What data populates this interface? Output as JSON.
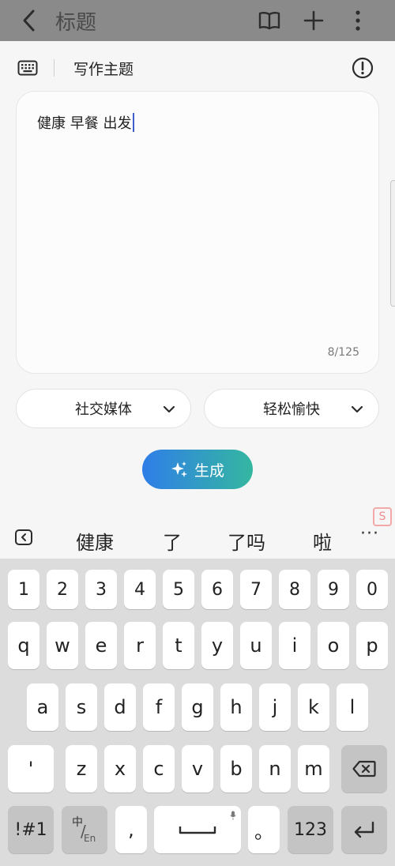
{
  "header": {
    "title": "标题",
    "back_icon": "chevron-left-icon",
    "actions": [
      "book-icon",
      "plus-icon",
      "more-vertical-icon"
    ]
  },
  "theme": {
    "label": "写作主题",
    "input_text": "健康 早餐 出发",
    "counter": "8/125"
  },
  "options": {
    "platform": "社交媒体",
    "tone": "轻松愉快"
  },
  "generate_label": "生成",
  "suggestions": [
    "健康",
    "了",
    "了吗",
    "啦"
  ],
  "suggestions_more": "···",
  "keyboard": {
    "numbers": [
      "1",
      "2",
      "3",
      "4",
      "5",
      "6",
      "7",
      "8",
      "9",
      "0"
    ],
    "row1": [
      "q",
      "w",
      "e",
      "r",
      "t",
      "y",
      "u",
      "i",
      "o",
      "p"
    ],
    "row2": [
      "a",
      "s",
      "d",
      "f",
      "g",
      "h",
      "j",
      "k",
      "l"
    ],
    "row3": [
      "'",
      "z",
      "x",
      "c",
      "v",
      "b",
      "n",
      "m"
    ],
    "symbols": "!#1",
    "lang_top": "中",
    "lang_bottom": "En",
    "comma": ",",
    "period": "。",
    "num": "123"
  },
  "colors": {
    "accent_start": "#2f7ee8",
    "accent_end": "#34b7a0",
    "caret": "#3c5fc9"
  }
}
